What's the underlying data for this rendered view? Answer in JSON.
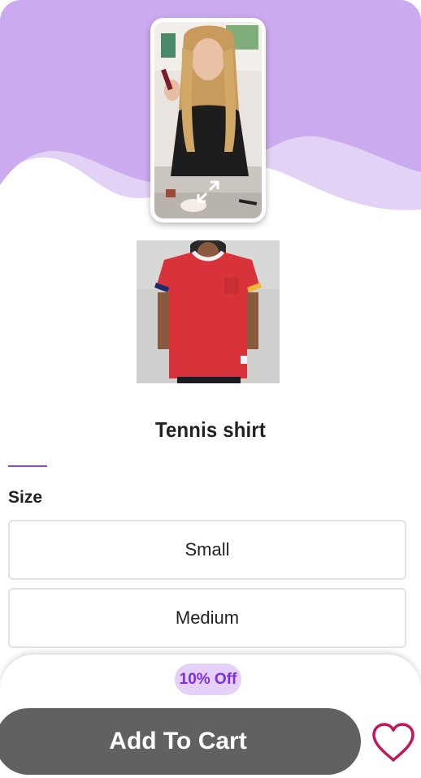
{
  "product": {
    "title": "Tennis shirt",
    "size_label": "Size",
    "sizes": [
      "Small",
      "Medium"
    ]
  },
  "cart": {
    "discount_badge": "10% Off",
    "add_to_cart_label": "Add To Cart"
  },
  "icons": {
    "expand": "expand-icon",
    "wishlist": "heart-icon"
  },
  "colors": {
    "hero_purple": "#cbaaf0",
    "hero_light": "#e2d2f6",
    "accent": "#8b45e8",
    "badge_bg": "#e5d0fa",
    "badge_text": "#7b2fe0",
    "cart_button": "#616161",
    "heart": "#c2185b"
  }
}
